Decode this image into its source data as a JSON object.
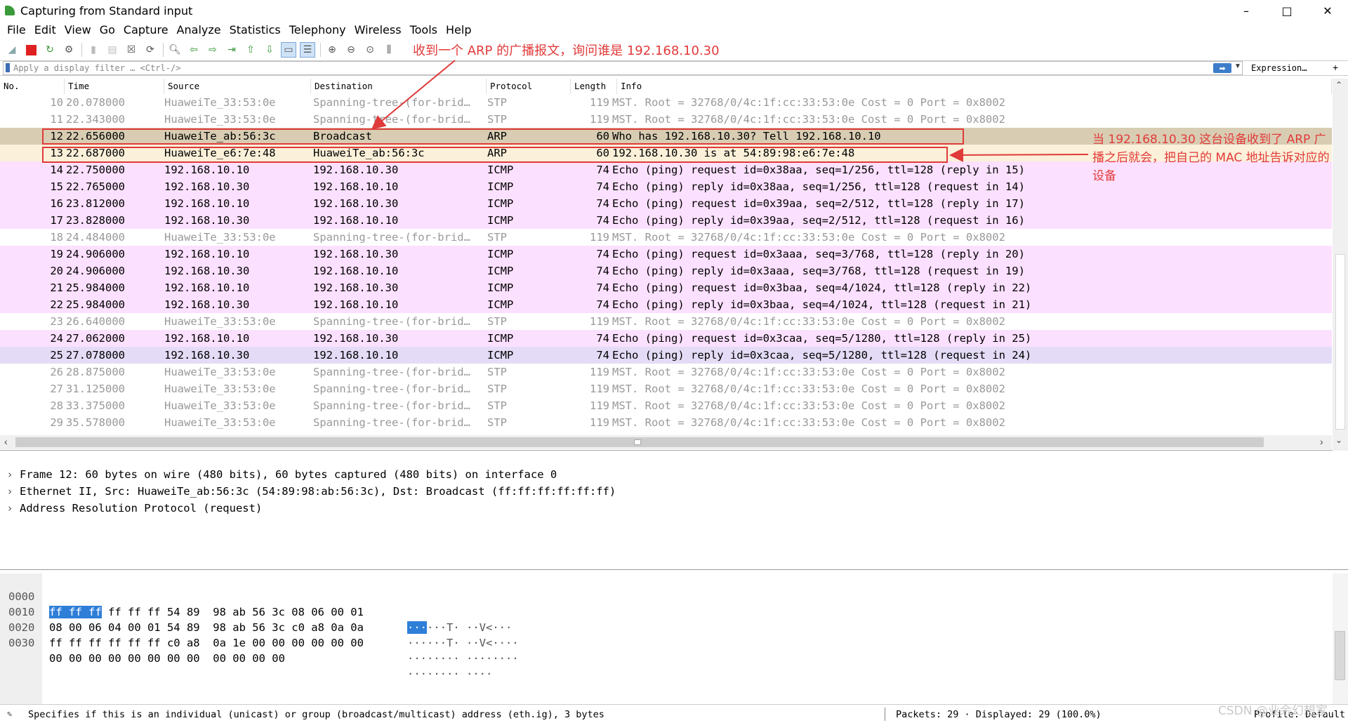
{
  "window": {
    "title": "Capturing from Standard input",
    "minimize": "–",
    "maximize": "□",
    "close": "✕"
  },
  "menu": [
    "File",
    "Edit",
    "View",
    "Go",
    "Capture",
    "Analyze",
    "Statistics",
    "Telephony",
    "Wireless",
    "Tools",
    "Help"
  ],
  "filter": {
    "placeholder": "Apply a display filter … <Ctrl-/>",
    "expression_label": "Expression…",
    "plus_label": "+"
  },
  "annotations": {
    "top": "收到一个 ARP 的广播报文，询问谁是 192.168.10.30",
    "right": "当 192.168.10.30 这台设备收到了 ARP 广播之后就会，把自己的 MAC 地址告诉对应的设备"
  },
  "columns": [
    "No.",
    "Time",
    "Source",
    "Destination",
    "Protocol",
    "Length",
    "Info"
  ],
  "packets": [
    {
      "no": "10",
      "time": "20.078000",
      "src": "HuaweiTe_33:53:0e",
      "dst": "Spanning-tree-(for-brid…",
      "proto": "STP",
      "len": "119",
      "info": "MST. Root = 32768/0/4c:1f:cc:33:53:0e  Cost = 0  Port = 0x8002",
      "kind": "stp"
    },
    {
      "no": "11",
      "time": "22.343000",
      "src": "HuaweiTe_33:53:0e",
      "dst": "Spanning-tree-(for-brid…",
      "proto": "STP",
      "len": "119",
      "info": "MST. Root = 32768/0/4c:1f:cc:33:53:0e  Cost = 0  Port = 0x8002",
      "kind": "stp"
    },
    {
      "no": "12",
      "time": "22.656000",
      "src": "HuaweiTe_ab:56:3c",
      "dst": "Broadcast",
      "proto": "ARP",
      "len": "60",
      "info": "Who has 192.168.10.30? Tell 192.168.10.10",
      "kind": "arp-sel"
    },
    {
      "no": "13",
      "time": "22.687000",
      "src": "HuaweiTe_e6:7e:48",
      "dst": "HuaweiTe_ab:56:3c",
      "proto": "ARP",
      "len": "60",
      "info": "192.168.10.30 is at 54:89:98:e6:7e:48",
      "kind": "arp"
    },
    {
      "no": "14",
      "time": "22.750000",
      "src": "192.168.10.10",
      "dst": "192.168.10.30",
      "proto": "ICMP",
      "len": "74",
      "info": "Echo (ping) request  id=0x38aa, seq=1/256, ttl=128 (reply in 15)",
      "kind": "icmp"
    },
    {
      "no": "15",
      "time": "22.765000",
      "src": "192.168.10.30",
      "dst": "192.168.10.10",
      "proto": "ICMP",
      "len": "74",
      "info": "Echo (ping) reply    id=0x38aa, seq=1/256, ttl=128 (request in 14)",
      "kind": "icmp"
    },
    {
      "no": "16",
      "time": "23.812000",
      "src": "192.168.10.10",
      "dst": "192.168.10.30",
      "proto": "ICMP",
      "len": "74",
      "info": "Echo (ping) request  id=0x39aa, seq=2/512, ttl=128 (reply in 17)",
      "kind": "icmp"
    },
    {
      "no": "17",
      "time": "23.828000",
      "src": "192.168.10.30",
      "dst": "192.168.10.10",
      "proto": "ICMP",
      "len": "74",
      "info": "Echo (ping) reply    id=0x39aa, seq=2/512, ttl=128 (request in 16)",
      "kind": "icmp"
    },
    {
      "no": "18",
      "time": "24.484000",
      "src": "HuaweiTe_33:53:0e",
      "dst": "Spanning-tree-(for-brid…",
      "proto": "STP",
      "len": "119",
      "info": "MST. Root = 32768/0/4c:1f:cc:33:53:0e  Cost = 0  Port = 0x8002",
      "kind": "stp"
    },
    {
      "no": "19",
      "time": "24.906000",
      "src": "192.168.10.10",
      "dst": "192.168.10.30",
      "proto": "ICMP",
      "len": "74",
      "info": "Echo (ping) request  id=0x3aaa, seq=3/768, ttl=128 (reply in 20)",
      "kind": "icmp"
    },
    {
      "no": "20",
      "time": "24.906000",
      "src": "192.168.10.30",
      "dst": "192.168.10.10",
      "proto": "ICMP",
      "len": "74",
      "info": "Echo (ping) reply    id=0x3aaa, seq=3/768, ttl=128 (request in 19)",
      "kind": "icmp"
    },
    {
      "no": "21",
      "time": "25.984000",
      "src": "192.168.10.10",
      "dst": "192.168.10.30",
      "proto": "ICMP",
      "len": "74",
      "info": "Echo (ping) request  id=0x3baa, seq=4/1024, ttl=128 (reply in 22)",
      "kind": "icmp"
    },
    {
      "no": "22",
      "time": "25.984000",
      "src": "192.168.10.30",
      "dst": "192.168.10.10",
      "proto": "ICMP",
      "len": "74",
      "info": "Echo (ping) reply    id=0x3baa, seq=4/1024, ttl=128 (request in 21)",
      "kind": "icmp"
    },
    {
      "no": "23",
      "time": "26.640000",
      "src": "HuaweiTe_33:53:0e",
      "dst": "Spanning-tree-(for-brid…",
      "proto": "STP",
      "len": "119",
      "info": "MST. Root = 32768/0/4c:1f:cc:33:53:0e  Cost = 0  Port = 0x8002",
      "kind": "stp"
    },
    {
      "no": "24",
      "time": "27.062000",
      "src": "192.168.10.10",
      "dst": "192.168.10.30",
      "proto": "ICMP",
      "len": "74",
      "info": "Echo (ping) request  id=0x3caa, seq=5/1280, ttl=128 (reply in 25)",
      "kind": "icmp"
    },
    {
      "no": "25",
      "time": "27.078000",
      "src": "192.168.10.30",
      "dst": "192.168.10.10",
      "proto": "ICMP",
      "len": "74",
      "info": "Echo (ping) reply    id=0x3caa, seq=5/1280, ttl=128 (request in 24)",
      "kind": "icmp-sel"
    },
    {
      "no": "26",
      "time": "28.875000",
      "src": "HuaweiTe_33:53:0e",
      "dst": "Spanning-tree-(for-brid…",
      "proto": "STP",
      "len": "119",
      "info": "MST. Root = 32768/0/4c:1f:cc:33:53:0e  Cost = 0  Port = 0x8002",
      "kind": "stp"
    },
    {
      "no": "27",
      "time": "31.125000",
      "src": "HuaweiTe_33:53:0e",
      "dst": "Spanning-tree-(for-brid…",
      "proto": "STP",
      "len": "119",
      "info": "MST. Root = 32768/0/4c:1f:cc:33:53:0e  Cost = 0  Port = 0x8002",
      "kind": "stp"
    },
    {
      "no": "28",
      "time": "33.375000",
      "src": "HuaweiTe_33:53:0e",
      "dst": "Spanning-tree-(for-brid…",
      "proto": "STP",
      "len": "119",
      "info": "MST. Root = 32768/0/4c:1f:cc:33:53:0e  Cost = 0  Port = 0x8002",
      "kind": "stp"
    },
    {
      "no": "29",
      "time": "35.578000",
      "src": "HuaweiTe_33:53:0e",
      "dst": "Spanning-tree-(for-brid…",
      "proto": "STP",
      "len": "119",
      "info": "MST. Root = 32768/0/4c:1f:cc:33:53:0e  Cost = 0  Port = 0x8002",
      "kind": "stp"
    }
  ],
  "details": [
    "Frame 12: 60 bytes on wire (480 bits), 60 bytes captured (480 bits) on interface 0",
    "Ethernet II, Src: HuaweiTe_ab:56:3c (54:89:98:ab:56:3c), Dst: Broadcast (ff:ff:ff:ff:ff:ff)",
    "Address Resolution Protocol (request)"
  ],
  "bytes": [
    {
      "offset": "0000",
      "hex_sel": "ff ff ff",
      "hex": " ff ff ff 54 89  98 ab 56 3c 08 06 00 01",
      "ascii_sel": "···",
      "ascii": "···T· ··V<···"
    },
    {
      "offset": "0010",
      "hex_sel": "",
      "hex": "08 00 06 04 00 01 54 89  98 ab 56 3c c0 a8 0a 0a",
      "ascii_sel": "",
      "ascii": "······T· ··V<····"
    },
    {
      "offset": "0020",
      "hex_sel": "",
      "hex": "ff ff ff ff ff ff c0 a8  0a 1e 00 00 00 00 00 00",
      "ascii_sel": "",
      "ascii": "········ ········"
    },
    {
      "offset": "0030",
      "hex_sel": "",
      "hex": "00 00 00 00 00 00 00 00  00 00 00 00",
      "ascii_sel": "",
      "ascii": "········ ····"
    }
  ],
  "status": {
    "text": "Specifies if this is an individual (unicast) or group (broadcast/multicast) address (eth.ig), 3 bytes",
    "packets": "Packets: 29 · Displayed: 29 (100.0%)",
    "profile": "Profile: Default",
    "watermark": "CSDN @业余幻想家"
  },
  "colors": {
    "annotation": "#e23a3a",
    "arp_row": "#fbf0d9",
    "arp_selected": "#d8cdb3",
    "icmp_row": "#fce0ff",
    "icmp_selected": "#e4dcf6",
    "byte_selection": "#2f7fd8"
  }
}
